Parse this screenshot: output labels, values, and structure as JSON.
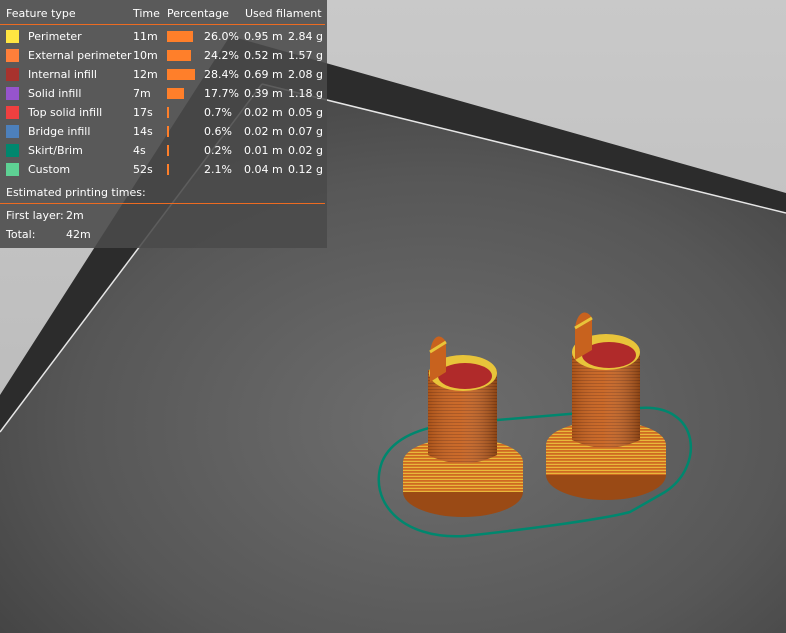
{
  "legend": {
    "headers": {
      "feature": "Feature type",
      "time": "Time",
      "percentage": "Percentage",
      "filament": "Used filament"
    },
    "rows": [
      {
        "color": "#ffe642",
        "name": "Perimeter",
        "time": "11m",
        "pct": "26.0%",
        "pct_value": 26.0,
        "length": "0.95 m",
        "weight": "2.84 g"
      },
      {
        "color": "#ff7f3a",
        "name": "External perimeter",
        "time": "10m",
        "pct": "24.2%",
        "pct_value": 24.2,
        "length": "0.52 m",
        "weight": "1.57 g"
      },
      {
        "color": "#a8322d",
        "name": "Internal infill",
        "time": "12m",
        "pct": "28.4%",
        "pct_value": 28.4,
        "length": "0.69 m",
        "weight": "2.08 g"
      },
      {
        "color": "#9654cc",
        "name": "Solid infill",
        "time": "7m",
        "pct": "17.7%",
        "pct_value": 17.7,
        "length": "0.39 m",
        "weight": "1.18 g"
      },
      {
        "color": "#f04040",
        "name": "Top solid infill",
        "time": "17s",
        "pct": "0.7%",
        "pct_value": 0.7,
        "length": "0.02 m",
        "weight": "0.05 g"
      },
      {
        "color": "#4d80bb",
        "name": "Bridge infill",
        "time": "14s",
        "pct": "0.6%",
        "pct_value": 0.6,
        "length": "0.02 m",
        "weight": "0.07 g"
      },
      {
        "color": "#00876e",
        "name": "Skirt/Brim",
        "time": "4s",
        "pct": "0.2%",
        "pct_value": 0.2,
        "length": "0.01 m",
        "weight": "0.02 g"
      },
      {
        "color": "#5ed194",
        "name": "Custom",
        "time": "52s",
        "pct": "2.1%",
        "pct_value": 2.1,
        "length": "0.04 m",
        "weight": "0.12 g"
      }
    ],
    "estimated_label": "Estimated printing times:",
    "first_layer_label": "First layer:",
    "first_layer_value": "2m",
    "total_label": "Total:",
    "total_value": "42m"
  },
  "colors": {
    "accent": "#ed6b21",
    "bar": "#ff7f2a",
    "background": "#4a4a4a",
    "model_orange": "#c8621e",
    "model_yellow": "#e8c43a",
    "model_red": "#b02a2a",
    "skirt": "#00876e"
  }
}
